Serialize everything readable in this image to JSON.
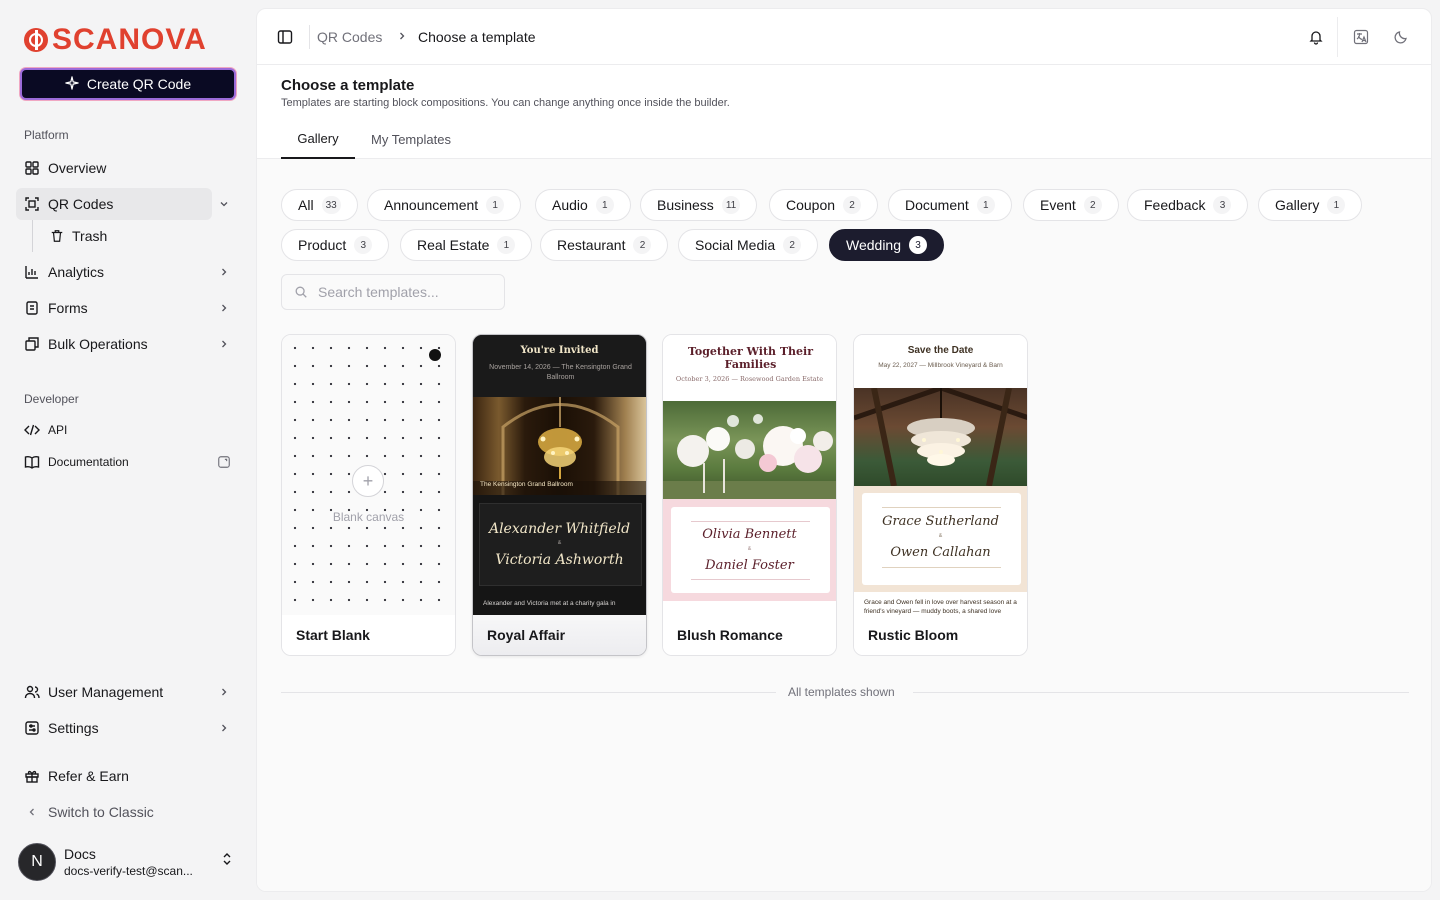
{
  "brand": {
    "name": "SCANOVA",
    "color": "#e0412f"
  },
  "sidebar": {
    "create_label": "Create QR Code",
    "platform_label": "Platform",
    "developer_label": "Developer",
    "items": {
      "overview": "Overview",
      "qr_codes": "QR Codes",
      "trash": "Trash",
      "analytics": "Analytics",
      "forms": "Forms",
      "bulk": "Bulk Operations",
      "api": "API",
      "documentation": "Documentation",
      "user_management": "User Management",
      "settings": "Settings",
      "refer": "Refer & Earn",
      "switch_classic": "Switch to Classic"
    },
    "user": {
      "initial": "N",
      "name": "Docs",
      "email": "docs-verify-test@scan..."
    }
  },
  "topbar": {
    "breadcrumb": [
      "QR Codes",
      "Choose a template"
    ],
    "icons": [
      "panel-toggle-icon",
      "bell-icon",
      "translate-icon",
      "moon-icon"
    ]
  },
  "page": {
    "title": "Choose a template",
    "subtitle": "Templates are starting block compositions. You can change anything once inside the builder.",
    "tabs": [
      "Gallery",
      "My Templates"
    ],
    "active_tab": "Gallery"
  },
  "filters": [
    {
      "label": "All",
      "count": "33"
    },
    {
      "label": "Announcement",
      "count": "1"
    },
    {
      "label": "Audio",
      "count": "1"
    },
    {
      "label": "Business",
      "count": "11"
    },
    {
      "label": "Coupon",
      "count": "2"
    },
    {
      "label": "Document",
      "count": "1"
    },
    {
      "label": "Event",
      "count": "2"
    },
    {
      "label": "Feedback",
      "count": "3"
    },
    {
      "label": "Gallery",
      "count": "1"
    },
    {
      "label": "Product",
      "count": "3"
    },
    {
      "label": "Real Estate",
      "count": "1"
    },
    {
      "label": "Restaurant",
      "count": "2"
    },
    {
      "label": "Social Media",
      "count": "2"
    },
    {
      "label": "Wedding",
      "count": "3",
      "selected": true
    }
  ],
  "search": {
    "placeholder": "Search templates..."
  },
  "templates": {
    "blank": {
      "name": "Start Blank",
      "canvas_label": "Blank canvas"
    },
    "royal": {
      "name": "Royal Affair",
      "heading": "You're Invited",
      "date_line": "November 14, 2026 — The Kensington Grand Ballroom",
      "caption": "The Kensington Grand Ballroom",
      "name1": "Alexander Whitfield",
      "amp": "&",
      "name2": "Victoria Ashworth",
      "story": "Alexander and Victoria met at a charity gala in"
    },
    "blush": {
      "name": "Blush Romance",
      "heading": "Together With Their Families",
      "date_line": "October 3, 2026 — Rosewood Garden Estate",
      "name1": "Olivia Bennett",
      "amp": "&",
      "name2": "Daniel Foster"
    },
    "rustic": {
      "name": "Rustic Bloom",
      "heading": "Save the Date",
      "date_line": "May 22, 2027 — Millbrook Vineyard & Barn",
      "name1": "Grace Sutherland",
      "amp": "&",
      "name2": "Owen Callahan",
      "story": "Grace and Owen fell in love over harvest season at a friend's vineyard — muddy boots, a shared love"
    }
  },
  "footer_note": "All templates shown"
}
